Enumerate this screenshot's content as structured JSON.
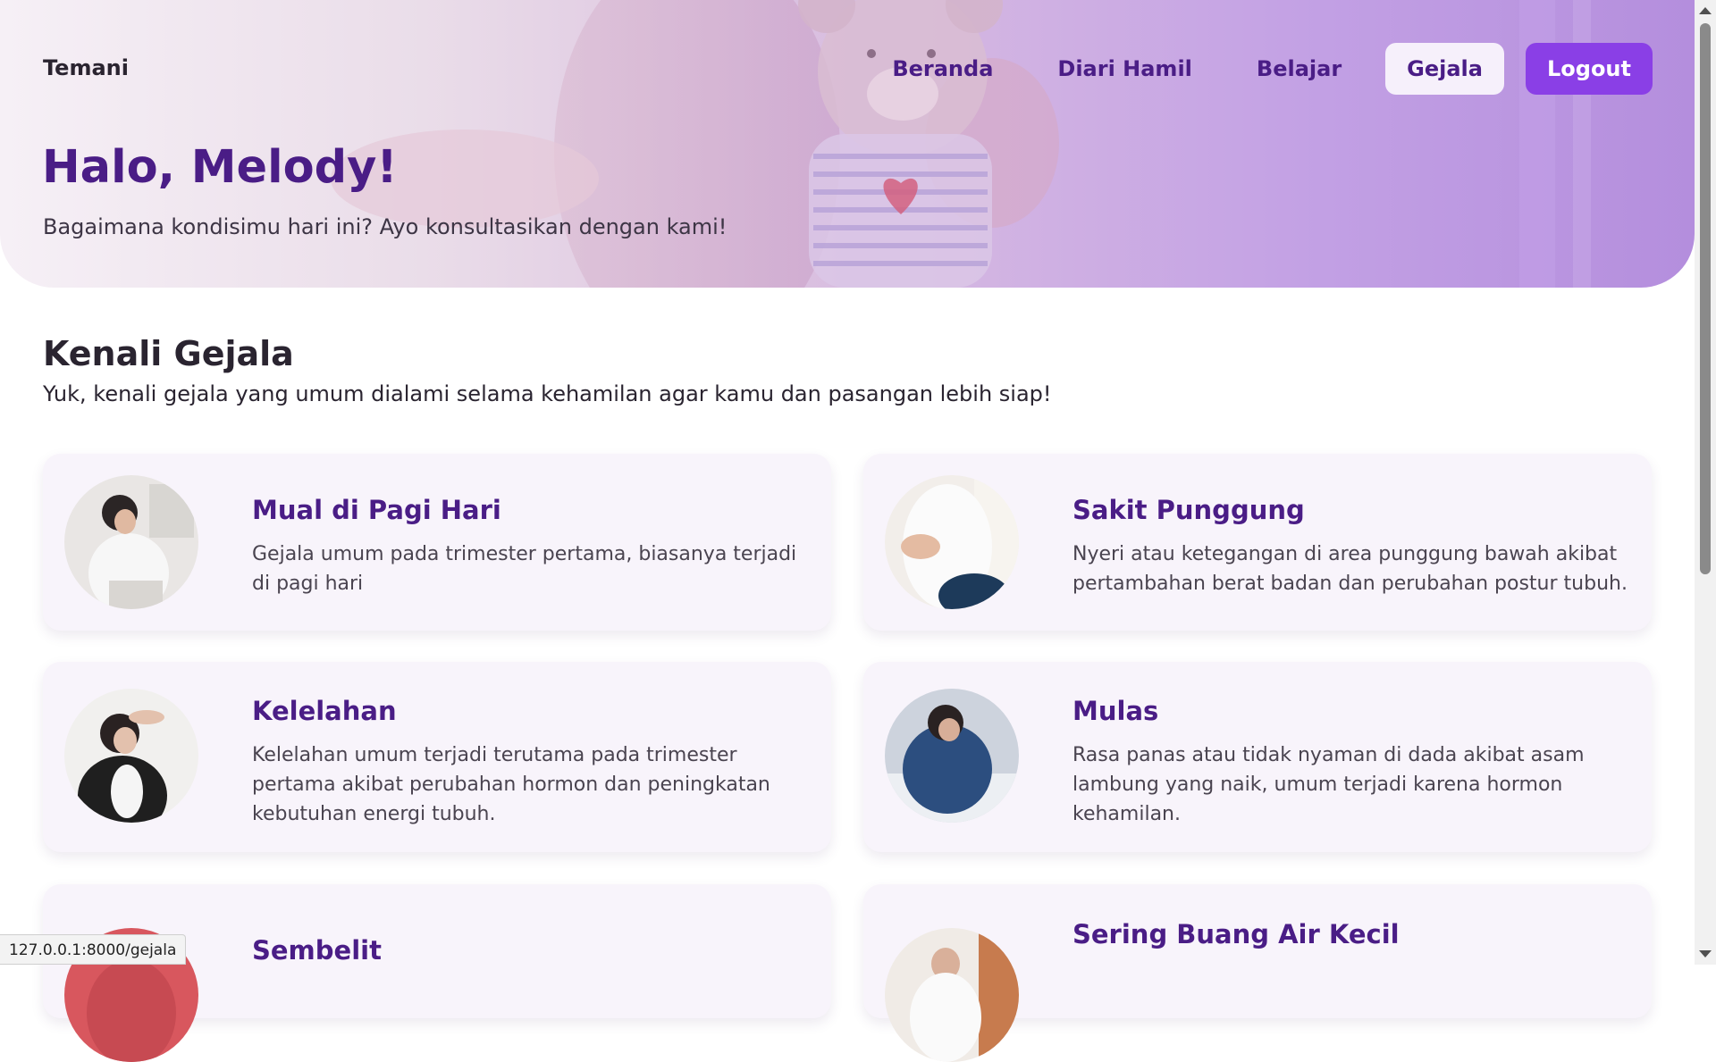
{
  "nav": {
    "brand": "Temani",
    "links": [
      "Beranda",
      "Diari Hamil",
      "Belajar"
    ],
    "active": "Gejala",
    "logout": "Logout"
  },
  "hero": {
    "greeting": "Halo, Melody!",
    "subtitle": "Bagaimana kondisimu hari ini? Ayo konsultasikan dengan kami!"
  },
  "section": {
    "title": "Kenali Gejala",
    "subtitle": "Yuk, kenali gejala yang umum dialami selama kehamilan agar kamu dan pasangan lebih siap!"
  },
  "cards": [
    {
      "title": "Mual di Pagi Hari",
      "description": "Gejala umum pada trimester pertama, biasanya terjadi di pagi hari"
    },
    {
      "title": "Sakit Punggung",
      "description": "Nyeri atau ketegangan di area punggung bawah akibat pertambahan berat badan dan perubahan postur tubuh."
    },
    {
      "title": "Kelelahan",
      "description": "Kelelahan umum terjadi terutama pada trimester pertama akibat perubahan hormon dan peningkatan kebutuhan energi tubuh."
    },
    {
      "title": "Mulas",
      "description": "Rasa panas atau tidak nyaman di dada akibat asam lambung yang naik, umum terjadi karena hormon kehamilan."
    },
    {
      "title": "Sembelit",
      "description": ""
    },
    {
      "title": "Sering Buang Air Kecil",
      "description": ""
    }
  ],
  "status_url": "127.0.0.1:8000/gejala",
  "colors": {
    "accent": "#8a3fe6",
    "heading": "#4a1d86",
    "card_bg": "#f8f4fb"
  }
}
